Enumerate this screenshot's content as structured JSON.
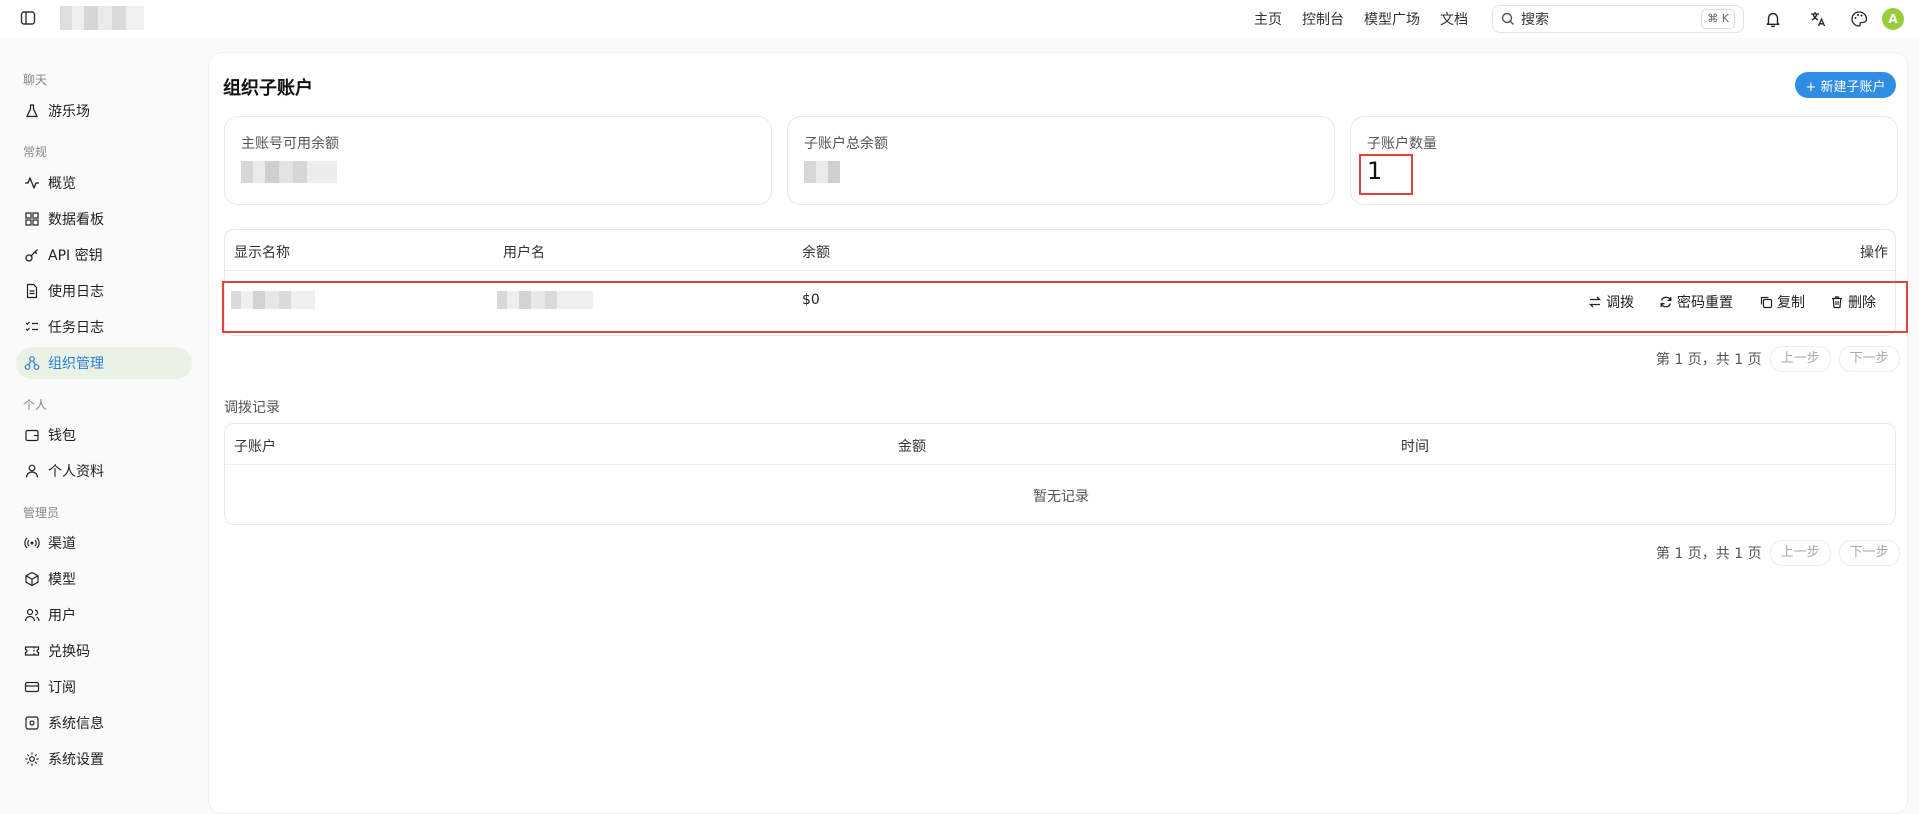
{
  "topbar": {
    "nav": [
      "主页",
      "控制台",
      "模型广场",
      "文档"
    ],
    "search_placeholder": "搜索",
    "search_shortcut": "⌘ K",
    "avatar_letter": "A"
  },
  "sidebar": {
    "sections": {
      "chat": "聊天",
      "general": "常规",
      "personal": "个人",
      "admin": "管理员"
    },
    "items": {
      "playground": "游乐场",
      "overview": "概览",
      "dashboard": "数据看板",
      "api_keys": "API 密钥",
      "usage_log": "使用日志",
      "task_log": "任务日志",
      "org_manage": "组织管理",
      "wallet": "钱包",
      "profile": "个人资料",
      "channels": "渠道",
      "models": "模型",
      "users": "用户",
      "redeem": "兑换码",
      "subscriptions": "订阅",
      "system_info": "系统信息",
      "system_settings": "系统设置"
    },
    "active": "org_manage"
  },
  "page": {
    "title": "组织子账户",
    "new_button": "+ 新建子账户"
  },
  "stats": {
    "main_balance_label": "主账号可用余额",
    "sub_total_label": "子账户总余额",
    "sub_count_label": "子账户数量",
    "sub_count_value": "1"
  },
  "subaccounts_table": {
    "headers": {
      "display_name": "显示名称",
      "username": "用户名",
      "balance": "余额",
      "actions": "操作"
    },
    "rows": [
      {
        "balance": "$0",
        "actions": {
          "transfer": "调拨",
          "reset_password": "密码重置",
          "copy": "复制",
          "delete": "删除"
        }
      }
    ]
  },
  "pager": {
    "text": "第 1 页，共 1 页",
    "prev": "上一步",
    "next": "下一步"
  },
  "transfer_records": {
    "title": "调拨记录",
    "headers": {
      "subaccount": "子账户",
      "amount": "金额",
      "time": "时间"
    },
    "empty_text": "暂无记录"
  },
  "colors": {
    "accent": "#2f8de4",
    "active_bg": "#eaf2e6",
    "highlight_red": "#e0453a",
    "avatar": "#9acd3c"
  }
}
